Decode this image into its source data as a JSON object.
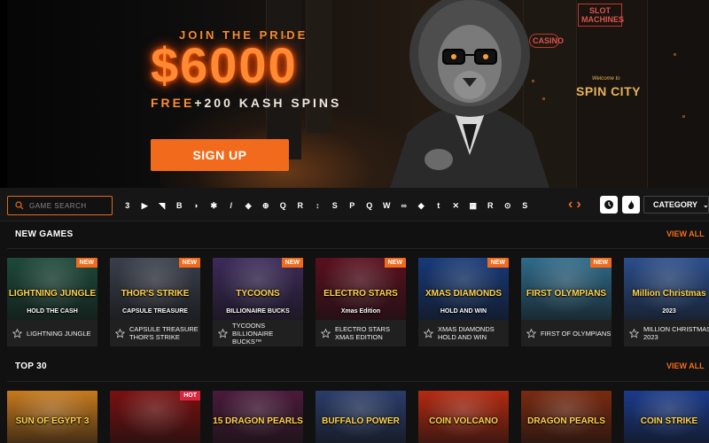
{
  "hero": {
    "tagline": "JOIN THE PRIDE",
    "amount": "$6000",
    "free_word": "FREE",
    "spins_text": "+200 KASH SPINS",
    "signup_label": "SIGN UP",
    "signs": {
      "casino": "CASINO",
      "slot_machines": "SLOT MACHINES",
      "welcome": "Welcome to",
      "spin_city": "SPIN CITY"
    }
  },
  "toolbar": {
    "search_placeholder": "GAME SEARCH",
    "providers": [
      "3",
      "▶",
      "◥",
      "B",
      "◗",
      "✱",
      "/",
      "◈",
      "⊕",
      "Q",
      "R",
      "↕",
      "S",
      "P",
      "Q",
      "W",
      "∞",
      "◆",
      "t",
      "✕",
      "▦",
      "R",
      "⊙",
      "S"
    ],
    "category_label": "CATEGORY",
    "icons": {
      "search": "search-icon",
      "prev": "chevron-left-icon",
      "next": "chevron-right-icon",
      "clock": "clock-icon",
      "fire": "fire-icon",
      "dropdown": "chevron-down-icon"
    }
  },
  "sections": {
    "new_games": {
      "title": "NEW GAMES",
      "view_all": "VIEW ALL",
      "games": [
        {
          "name": "LIGHTNING JUNGLE",
          "art_title": "LIGHTNING JUNGLE",
          "art_sub": "HOLD THE CASH",
          "badge": "NEW",
          "bg": "#1d4a3a"
        },
        {
          "name": "CAPSULE TREASURE THOR'S STRIKE",
          "art_title": "THOR'S STRIKE",
          "art_sub": "CAPSULE TREASURE",
          "badge": "NEW",
          "bg": "#3a3f4c"
        },
        {
          "name": "TYCOONS BILLIONAIRE BUCKS™",
          "art_title": "TYCOONS",
          "art_sub": "BILLIONAIRE BUCKS",
          "badge": "NEW",
          "bg": "#3c2a5a"
        },
        {
          "name": "ELECTRO STARS XMAS EDITION",
          "art_title": "ELECTRO STARS",
          "art_sub": "Xmas Edition",
          "badge": "NEW",
          "bg": "#5a0f1e"
        },
        {
          "name": "XMAS DIAMONDS HOLD AND WIN",
          "art_title": "XMAS DIAMONDS",
          "art_sub": "HOLD AND WIN",
          "badge": "NEW",
          "bg": "#173a7a"
        },
        {
          "name": "FIRST OF OLYMPIANS",
          "art_title": "FIRST OLYMPIANS",
          "art_sub": "",
          "badge": "NEW",
          "bg": "#2f6b8a"
        },
        {
          "name": "MILLION CHRISTMAS 2023",
          "art_title": "Million Christmas",
          "art_sub": "2023",
          "badge": "",
          "bg": "#2b4e8c"
        }
      ]
    },
    "top30": {
      "title": "TOP 30",
      "view_all": "VIEW ALL",
      "games": [
        {
          "art_title": "SUN OF EGYPT 3",
          "badge": "",
          "bg": "#c77a1c"
        },
        {
          "art_title": "",
          "badge": "HOT",
          "bg": "#7a1010"
        },
        {
          "art_title": "15 DRAGON PEARLS",
          "badge": "",
          "bg": "#4a1a3a"
        },
        {
          "art_title": "BUFFALO POWER",
          "badge": "",
          "bg": "#2a3c6a"
        },
        {
          "art_title": "COIN VOLCANO",
          "badge": "",
          "bg": "#b42a10"
        },
        {
          "art_title": "DRAGON PEARLS",
          "badge": "",
          "bg": "#7a2a10"
        },
        {
          "art_title": "COIN STRIKE",
          "badge": "",
          "bg": "#1a3a8a"
        }
      ]
    }
  }
}
